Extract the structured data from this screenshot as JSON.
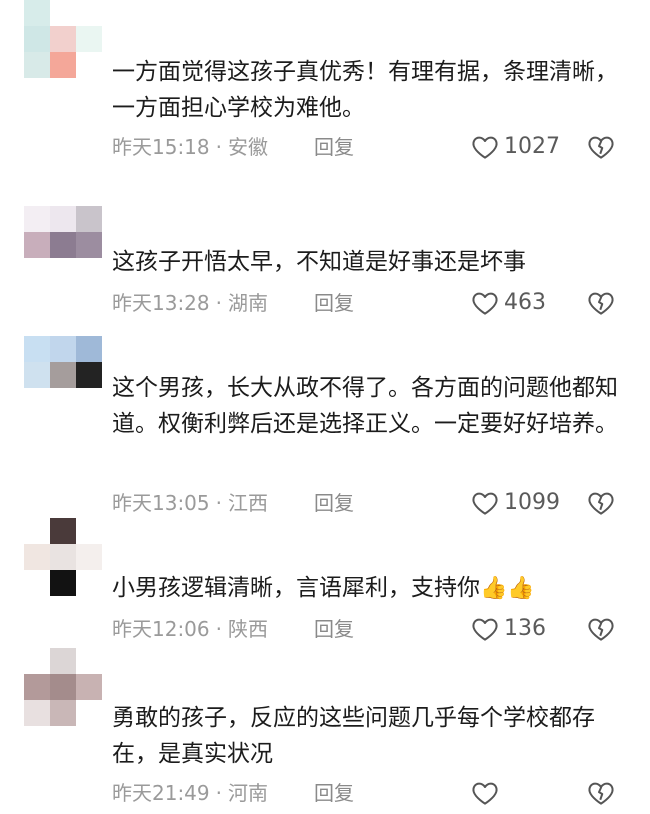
{
  "comments": [
    {
      "text": "一方面觉得这孩子真优秀！有理有据，条理清晰，一方面担心学校为难他。",
      "time": "昨天15:18",
      "location": "安徽",
      "reply": "回复",
      "likes": "1027"
    },
    {
      "text": "这孩子开悟太早，不知道是好事还是坏事",
      "time": "昨天13:28",
      "location": "湖南",
      "reply": "回复",
      "likes": "463"
    },
    {
      "text": "这个男孩，长大从政不得了。各方面的问题他都知道。权衡利弊后还是选择正义。一定要好好培养。",
      "time": "昨天13:05",
      "location": "江西",
      "reply": "回复",
      "likes": "1099"
    },
    {
      "text": "小男孩逻辑清晰，言语犀利，支持你",
      "emoji": "👍👍",
      "time": "昨天12:06",
      "location": "陕西",
      "reply": "回复",
      "likes": "136"
    },
    {
      "text": "勇敢的孩子，反应的这些问题几乎每个学校都存在，是真实状况",
      "time": "昨天21:49",
      "location": "河南",
      "reply": "回复",
      "likes": ""
    }
  ],
  "separator": "·",
  "colors": {
    "avatar1": [
      "#d7ecea",
      "#ffffff",
      "#ffffff",
      "#cfe7e6",
      "#f2d0cd",
      "#eaf6f2",
      "#d8eae8",
      "#f4a799",
      "#ffffff"
    ],
    "avatar2": [
      "#f3eef3",
      "#ede7ee",
      "#c9c4cb",
      "#c8aebb",
      "#8c7c91",
      "#9c8da0",
      "#ffffff",
      "#ffffff",
      "#ffffff"
    ],
    "avatar3": [
      "#c8dff2",
      "#c1d6ec",
      "#9fb9d8",
      "#cfe1ef",
      "#a59d9c",
      "#232323",
      "#ffffff",
      "#ffffff",
      "#ffffff"
    ],
    "avatar4": [
      "#ffffff",
      "#4a3a3a",
      "#ffffff",
      "#f0e6e1",
      "#e9e3e1",
      "#f4efed",
      "#ffffff",
      "#121212",
      "#ffffff"
    ],
    "avatar5": [
      "#ffffff",
      "#dcd6d6",
      "#ffffff",
      "#b39a9a",
      "#a48c8c",
      "#c8b2b2",
      "#e8e0e0",
      "#c9b7b7",
      "#ffffff"
    ]
  }
}
